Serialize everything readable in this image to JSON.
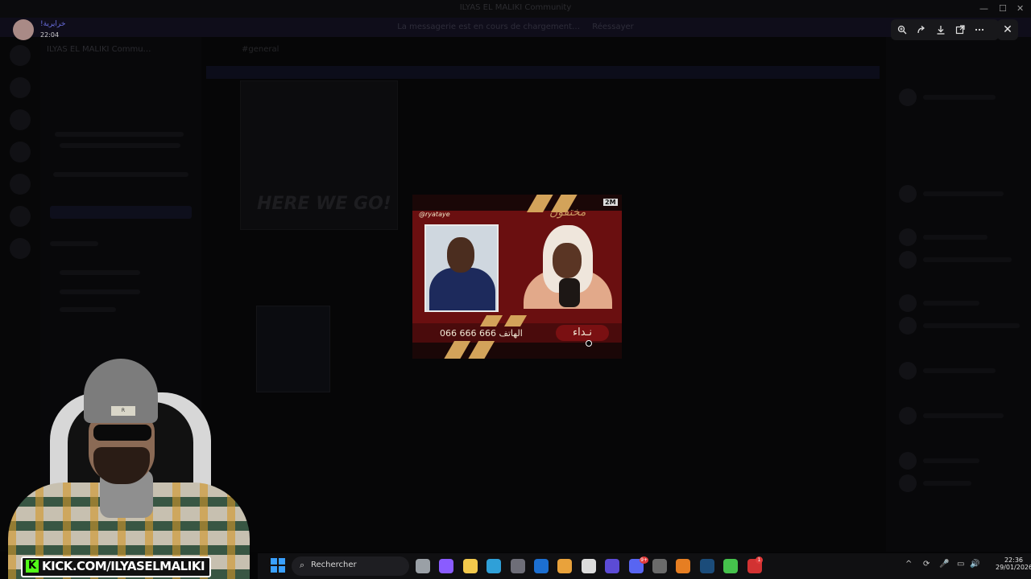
{
  "window": {
    "title": "ILYAS EL MALIKI Community",
    "controls": [
      "—",
      "☐",
      "✕"
    ]
  },
  "notice": {
    "text": "La messagerie est en cours de chargement…",
    "button": "Réessayer"
  },
  "server_name": "ILYAS EL MALIKI Commu…",
  "chat_channel": "#general",
  "here_we_go": "HERE WE GO!",
  "viewer": {
    "user_name": "!خرايرية",
    "time": "22:04",
    "tools": [
      "zoom-in-icon",
      "forward-icon",
      "download-icon",
      "open-external-icon",
      "more-icon"
    ],
    "close": "✕"
  },
  "image": {
    "tag": "@ryataye",
    "logo": "2M",
    "title_ar": "مختفون",
    "phone": "066 666 666 الهاتف",
    "nidaa": "نـداء"
  },
  "stream": {
    "kick_logo": "K",
    "kick_url": "KICK.COM/ILYASELMALIKI",
    "beanie_label": "R"
  },
  "taskbar": {
    "search_placeholder": "Rechercher",
    "search_icon": "⌕",
    "apps": [
      {
        "name": "task-view",
        "color": "#9aa0a6"
      },
      {
        "name": "copilot",
        "color": "#8a5cff"
      },
      {
        "name": "file-explorer",
        "color": "#f2c94c"
      },
      {
        "name": "edge",
        "color": "#2fa0d8"
      },
      {
        "name": "store",
        "color": "#6e6e78"
      },
      {
        "name": "outlook",
        "color": "#1c6fd1"
      },
      {
        "name": "chrome",
        "color": "#e9a23b"
      },
      {
        "name": "capcut",
        "color": "#dcdcdc"
      },
      {
        "name": "game-app",
        "color": "#5c4bd6"
      },
      {
        "name": "discord",
        "color": "#5865f2"
      },
      {
        "name": "obs",
        "color": "#6b6b6b"
      },
      {
        "name": "app-a",
        "color": "#e67e22"
      },
      {
        "name": "steam",
        "color": "#1b4c7a"
      },
      {
        "name": "play-app",
        "color": "#45c24c"
      },
      {
        "name": "stream-app",
        "color": "#d23232"
      }
    ],
    "discord_badge": "9+",
    "stream_badge": "1",
    "tray": [
      "^",
      "⟳",
      "🎤",
      "▭",
      "🔊"
    ],
    "time": "22:36",
    "date": "29/01/2026"
  }
}
